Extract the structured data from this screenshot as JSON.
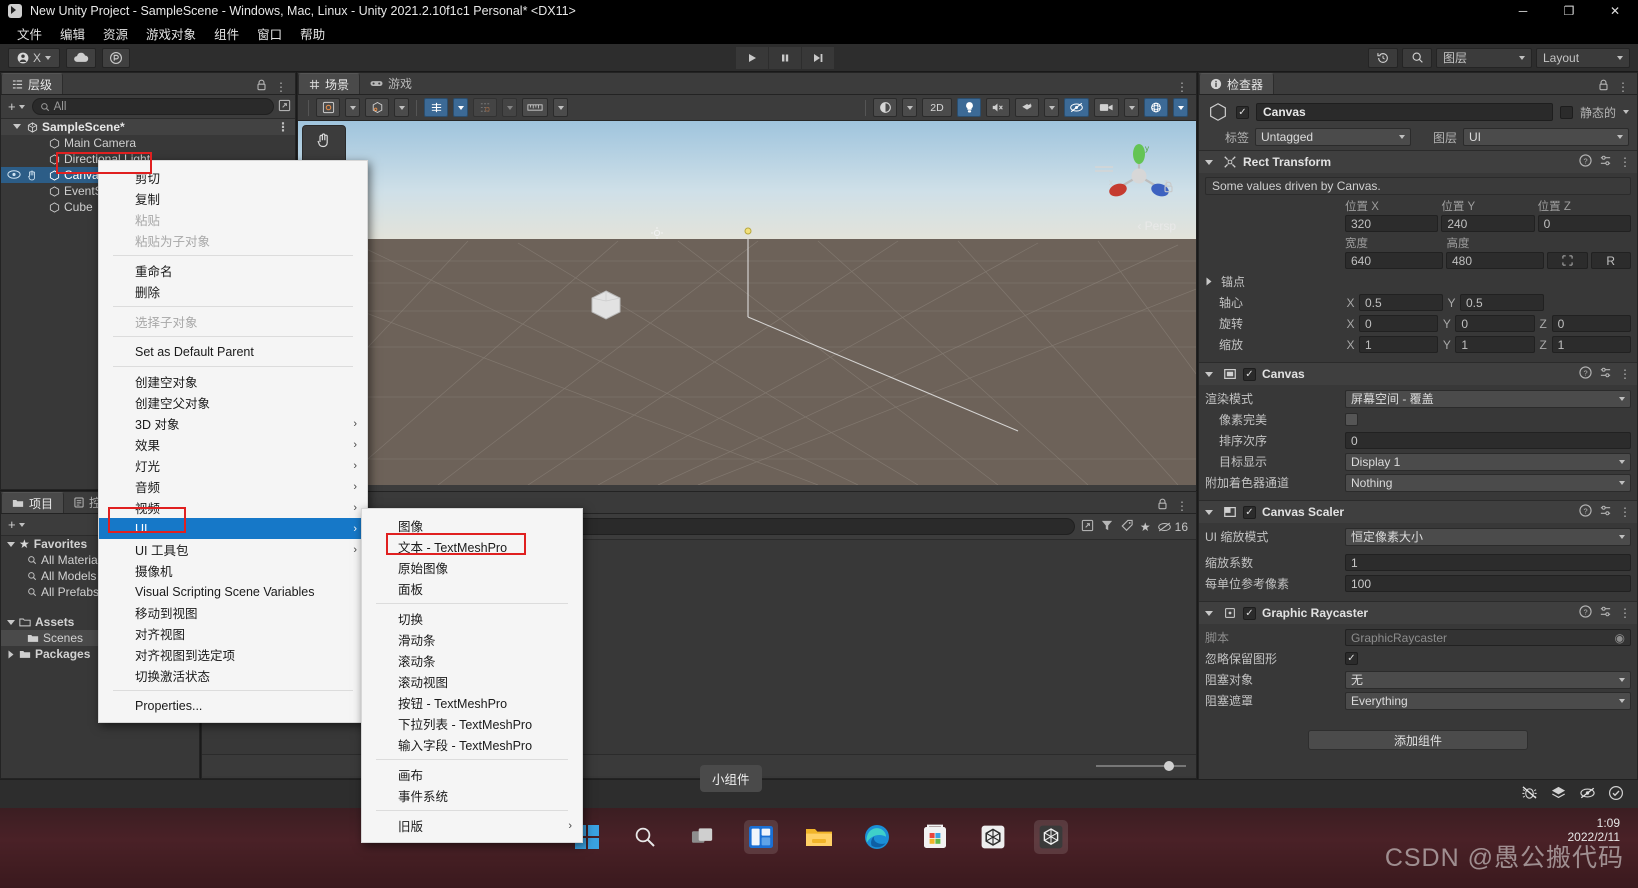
{
  "window": {
    "title": "New Unity Project - SampleScene - Windows, Mac, Linux - Unity 2021.2.10f1c1 Personal* <DX11>",
    "minimize": "─",
    "maximize": "❐",
    "close": "✕"
  },
  "menubar": {
    "items": [
      "文件",
      "编辑",
      "资源",
      "游戏对象",
      "组件",
      "窗口",
      "帮助"
    ]
  },
  "toolbar": {
    "account": "X",
    "play": "▶",
    "pause": "❙❙",
    "step": "▶❙",
    "layers_label": "图层",
    "layout_label": "Layout",
    "undo_icon": "history-icon",
    "search_icon": "search-icon"
  },
  "hierarchy": {
    "tab": "层级",
    "search_placeholder": "All",
    "rows": [
      {
        "label": "SampleScene*",
        "depth": 0,
        "type": "scene"
      },
      {
        "label": "Main Camera",
        "depth": 1,
        "type": "object"
      },
      {
        "label": "Directional Light",
        "depth": 1,
        "type": "object"
      },
      {
        "label": "Canvas",
        "depth": 1,
        "type": "object",
        "selected": true
      },
      {
        "label": "EventSystem",
        "depth": 1,
        "type": "object"
      },
      {
        "label": "Cube",
        "depth": 1,
        "type": "object"
      }
    ]
  },
  "scene": {
    "tabs": [
      {
        "label": "场景",
        "icon": "grid-icon",
        "active": true
      },
      {
        "label": "游戏",
        "icon": "gamepad-icon",
        "active": false
      }
    ],
    "toolbar_left": [
      "shaded-dd",
      "cube-dd",
      "gizmo-2d-dd",
      "snap-dd",
      "grid-dd"
    ],
    "toolbar_right": [
      "draw-mode",
      "2D",
      "lighting",
      "audio",
      "fx",
      "hidden",
      "camera",
      "gizmos"
    ],
    "btn_2d": "2D",
    "persp_label": "‹ Persp",
    "gizmo_axes": {
      "x": "x",
      "y": "y",
      "z": "z"
    }
  },
  "project": {
    "tabs": [
      {
        "label": "项目",
        "active": true
      },
      {
        "label": "控制台",
        "active": false
      }
    ],
    "tree": [
      {
        "label": "Favorites",
        "depth": 0,
        "icon": "star-icon",
        "expanded": true
      },
      {
        "label": "All Materials",
        "depth": 1,
        "icon": "search-icon"
      },
      {
        "label": "All Models",
        "depth": 1,
        "icon": "search-icon"
      },
      {
        "label": "All Prefabs",
        "depth": 1,
        "icon": "search-icon"
      },
      {
        "label": "Assets",
        "depth": 0,
        "icon": "folder-icon",
        "expanded": true
      },
      {
        "label": "Scenes",
        "depth": 1,
        "icon": "folder-icon",
        "selected": true
      },
      {
        "label": "Packages",
        "depth": 0,
        "icon": "folder-icon",
        "expanded": false
      }
    ]
  },
  "projectbrowser": {
    "search_placeholder": "",
    "count_badge": "16"
  },
  "inspector": {
    "tab": "检查器",
    "object_name": "Canvas",
    "static_label": "静态的",
    "tag_label": "标签",
    "tag_value": "Untagged",
    "layer_label": "图层",
    "layer_value": "UI",
    "components": [
      {
        "title": "Rect Transform",
        "icon": "rect-transform-icon",
        "has_checkbox": false,
        "info": "Some values driven by Canvas.",
        "column_headers": [
          "位置 X",
          "位置 Y",
          "位置 Z"
        ],
        "pos": [
          "320",
          "240",
          "0"
        ],
        "size_headers": [
          "宽度",
          "高度"
        ],
        "size": [
          "640",
          "480"
        ],
        "anchor_label": "锚点",
        "pivot_label": "轴心",
        "pivot": [
          "0.5",
          "0.5"
        ],
        "rotation_label": "旋转",
        "rotation": [
          "0",
          "0",
          "0"
        ],
        "scale_label": "缩放",
        "scale": [
          "1",
          "1",
          "1"
        ],
        "blueprint_btn": "R"
      },
      {
        "title": "Canvas",
        "icon": "canvas-icon",
        "has_checkbox": true,
        "checked": true,
        "fields": [
          {
            "label": "渲染模式",
            "value": "屏幕空间 - 覆盖",
            "kind": "dropdown"
          },
          {
            "label": "像素完美",
            "value": "",
            "kind": "checkbox",
            "checked": false,
            "indent": true
          },
          {
            "label": "排序次序",
            "value": "0",
            "kind": "text",
            "indent": true
          },
          {
            "label": "目标显示",
            "value": "Display 1",
            "kind": "dropdown",
            "indent": true
          },
          {
            "label": "附加着色器通道",
            "value": "Nothing",
            "kind": "dropdown"
          }
        ]
      },
      {
        "title": "Canvas Scaler",
        "icon": "canvas-scaler-icon",
        "has_checkbox": true,
        "checked": true,
        "fields": [
          {
            "label": "UI 缩放模式",
            "value": "恒定像素大小",
            "kind": "dropdown"
          },
          {
            "label": "缩放系数",
            "value": "1",
            "kind": "text"
          },
          {
            "label": "每单位参考像素",
            "value": "100",
            "kind": "text"
          }
        ]
      },
      {
        "title": "Graphic Raycaster",
        "icon": "raycaster-icon",
        "has_checkbox": true,
        "checked": true,
        "fields": [
          {
            "label": "脚本",
            "value": "GraphicRaycaster",
            "kind": "object",
            "disabled": true
          },
          {
            "label": "忽略保留图形",
            "value": "",
            "kind": "checkbox",
            "checked": true
          },
          {
            "label": "阻塞对象",
            "value": "无",
            "kind": "dropdown"
          },
          {
            "label": "阻塞遮罩",
            "value": "Everything",
            "kind": "dropdown"
          }
        ]
      }
    ],
    "add_component": "添加组件"
  },
  "context_menu_main": {
    "items": [
      {
        "label": "剪切",
        "kind": "item"
      },
      {
        "label": "复制",
        "kind": "item"
      },
      {
        "label": "粘贴",
        "kind": "item",
        "disabled": true
      },
      {
        "label": "粘贴为子对象",
        "kind": "item",
        "disabled": true
      },
      {
        "kind": "separator"
      },
      {
        "label": "重命名",
        "kind": "item"
      },
      {
        "label": "删除",
        "kind": "item"
      },
      {
        "kind": "separator"
      },
      {
        "label": "选择子对象",
        "kind": "item",
        "disabled": true
      },
      {
        "kind": "separator"
      },
      {
        "label": "Set as Default Parent",
        "kind": "item"
      },
      {
        "kind": "separator"
      },
      {
        "label": "创建空对象",
        "kind": "item"
      },
      {
        "label": "创建空父对象",
        "kind": "item"
      },
      {
        "label": "3D 对象",
        "kind": "submenu"
      },
      {
        "label": "效果",
        "kind": "submenu"
      },
      {
        "label": "灯光",
        "kind": "submenu"
      },
      {
        "label": "音频",
        "kind": "submenu"
      },
      {
        "label": "视频",
        "kind": "submenu"
      },
      {
        "label": "UI",
        "kind": "submenu",
        "highlighted": true
      },
      {
        "label": "UI 工具包",
        "kind": "submenu"
      },
      {
        "label": "摄像机",
        "kind": "item"
      },
      {
        "label": "Visual Scripting Scene Variables",
        "kind": "item"
      },
      {
        "label": "移动到视图",
        "kind": "item"
      },
      {
        "label": "对齐视图",
        "kind": "item"
      },
      {
        "label": "对齐视图到选定项",
        "kind": "item"
      },
      {
        "label": "切换激活状态",
        "kind": "item"
      },
      {
        "kind": "separator"
      },
      {
        "label": "Properties...",
        "kind": "item"
      }
    ]
  },
  "context_menu_ui": {
    "items": [
      {
        "label": "图像",
        "kind": "item"
      },
      {
        "label": "文本 - TextMeshPro",
        "kind": "item",
        "boxed": true
      },
      {
        "label": "原始图像",
        "kind": "item"
      },
      {
        "label": "面板",
        "kind": "item"
      },
      {
        "kind": "separator"
      },
      {
        "label": "切换",
        "kind": "item"
      },
      {
        "label": "滑动条",
        "kind": "item"
      },
      {
        "label": "滚动条",
        "kind": "item"
      },
      {
        "label": "滚动视图",
        "kind": "item"
      },
      {
        "label": "按钮 - TextMeshPro",
        "kind": "item"
      },
      {
        "label": "下拉列表 - TextMeshPro",
        "kind": "item"
      },
      {
        "label": "输入字段 - TextMeshPro",
        "kind": "item"
      },
      {
        "kind": "separator"
      },
      {
        "label": "画布",
        "kind": "item"
      },
      {
        "label": "事件系统",
        "kind": "item"
      },
      {
        "kind": "separator"
      },
      {
        "label": "旧版",
        "kind": "submenu"
      }
    ]
  },
  "taskbar": {
    "tooltip": "小组件",
    "icons": [
      "start-icon",
      "search-icon",
      "taskview-icon",
      "widgets-icon",
      "explorer-icon",
      "edge-icon",
      "store-icon",
      "unityhub-icon",
      "unity-icon"
    ],
    "clock_time": "1:09",
    "clock_date": "2022/2/11",
    "watermark": "CSDN @愚公搬代码"
  },
  "colors": {
    "accent_blue": "#1678c8",
    "selection_blue": "#2c5d87",
    "panel_bg": "#383838",
    "highlight_red": "#e02020"
  }
}
